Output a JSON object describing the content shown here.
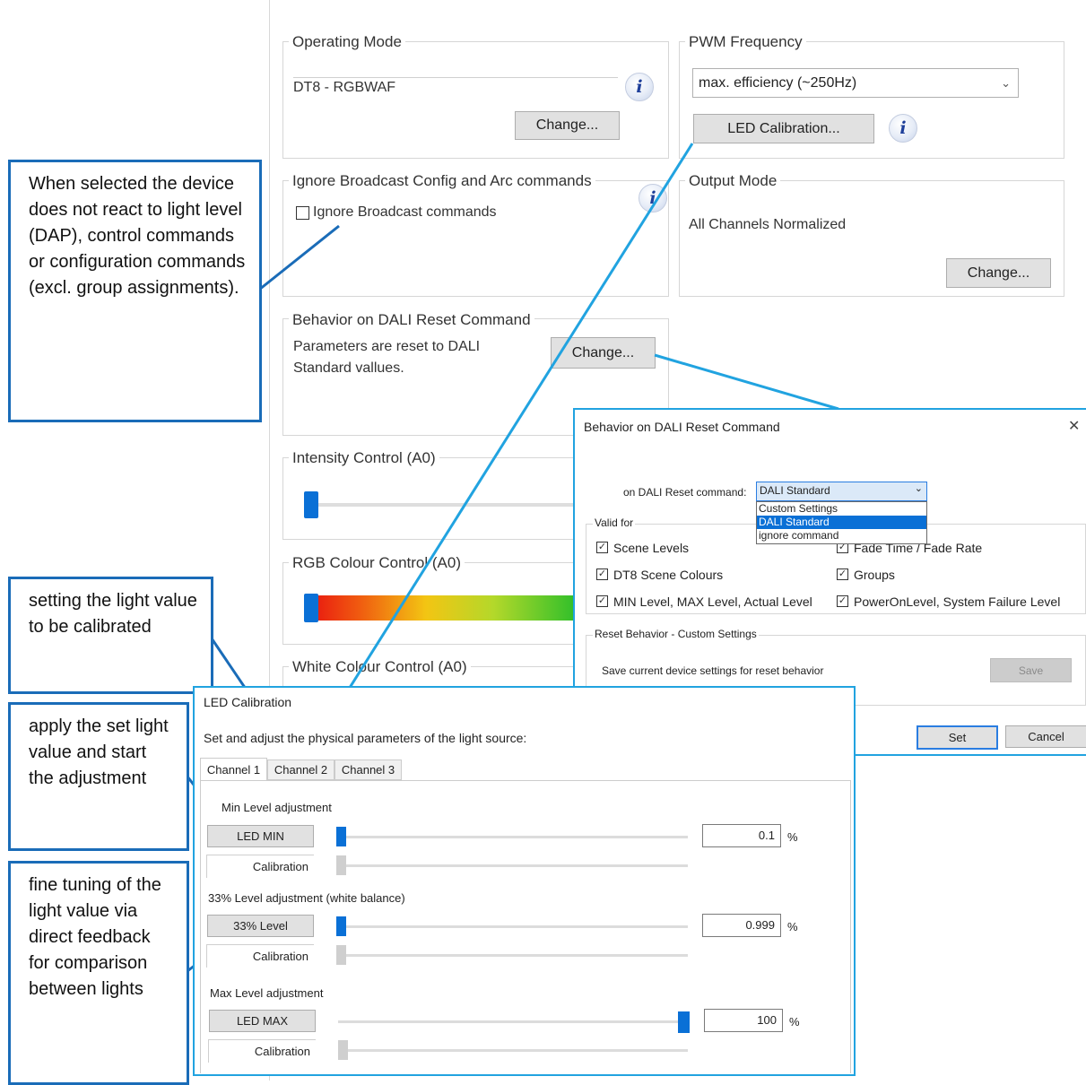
{
  "main": {
    "operating_mode": {
      "title": "Operating Mode",
      "value": "DT8 - RGBWAF",
      "change_label": "Change..."
    },
    "pwm_frequency": {
      "title": "PWM Frequency",
      "selected": "max. efficiency (~250Hz)",
      "calibration_label": "LED Calibration..."
    },
    "ignore_broadcast": {
      "title": "Ignore Broadcast Config and Arc commands",
      "checkbox_label": "Ignore Broadcast commands",
      "checked": false
    },
    "output_mode": {
      "title": "Output Mode",
      "value": "All Channels Normalized",
      "change_label": "Change..."
    },
    "reset_behavior": {
      "title": "Behavior on DALI Reset Command",
      "text_line1": "Parameters are reset to DALI",
      "text_line2": "Standard vallues.",
      "change_label": "Change..."
    },
    "intensity": {
      "title": "Intensity Control (A0)"
    },
    "rgb": {
      "title": "RGB Colour Control (A0)"
    },
    "white": {
      "title": "White Colour Control (A0)"
    }
  },
  "callouts": {
    "broadcast": "When selected the device does not react to light level (DAP), control commands or configuration commands (excl. group assignments).",
    "set_value": "setting the light value to be calibrated",
    "apply": "apply the set light value and start the adjustment",
    "fine_tune": "fine tuning of the light value via direct feedback for comparison between lights"
  },
  "reset_dialog": {
    "title": "Behavior on DALI Reset Command",
    "close": "✕",
    "command_label": "on DALI Reset command:",
    "selected": "DALI Standard",
    "options": [
      "Custom Settings",
      "DALI Standard",
      "ignore command"
    ],
    "valid_for_title": "Valid for",
    "valid_items": [
      "Scene Levels",
      "Fade Time / Fade Rate",
      "DT8 Scene Colours",
      "Groups",
      "MIN Level, MAX Level, Actual Level",
      "PowerOnLevel, System Failure Level"
    ],
    "custom_title": "Reset Behavior - Custom Settings",
    "custom_text": "Save current device settings for reset behavior",
    "save_label": "Save",
    "set_label": "Set",
    "cancel_label": "Cancel"
  },
  "calibration_dialog": {
    "title": "LED Calibration",
    "subtitle": "Set and adjust the physical parameters of the light source:",
    "tabs": [
      "Channel 1",
      "Channel 2",
      "Channel 3"
    ],
    "min": {
      "title": "Min Level adjustment",
      "button": "LED MIN",
      "calibration": "Calibration",
      "value": "0.1",
      "unit": "%"
    },
    "mid": {
      "title": "33% Level adjustment (white balance)",
      "button": "33% Level",
      "calibration": "Calibration",
      "value": "0.999",
      "unit": "%"
    },
    "max": {
      "title": "Max Level adjustment",
      "button": "LED MAX",
      "calibration": "Calibration",
      "value": "100",
      "unit": "%"
    }
  },
  "colors": {
    "accent": "#0a70d6",
    "callout_border": "#1a6cb8",
    "dialog_border": "#21a3e0"
  }
}
